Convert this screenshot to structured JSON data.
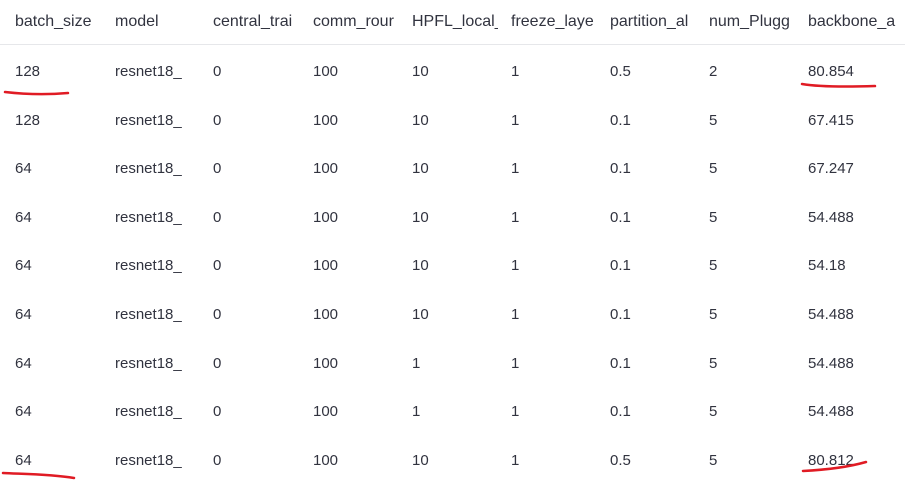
{
  "table": {
    "columns": [
      "batch_size",
      "model",
      "central_trai",
      "comm_rour",
      "HPFL_local_",
      "freeze_laye",
      "partition_al",
      "num_Plugg",
      "backbone_a"
    ],
    "rows": [
      [
        "128",
        "resnet18_",
        "0",
        "100",
        "10",
        "1",
        "0.5",
        "2",
        "80.854"
      ],
      [
        "128",
        "resnet18_",
        "0",
        "100",
        "10",
        "1",
        "0.1",
        "5",
        "67.415"
      ],
      [
        "64",
        "resnet18_",
        "0",
        "100",
        "10",
        "1",
        "0.1",
        "5",
        "67.247"
      ],
      [
        "64",
        "resnet18_",
        "0",
        "100",
        "10",
        "1",
        "0.1",
        "5",
        "54.488"
      ],
      [
        "64",
        "resnet18_",
        "0",
        "100",
        "10",
        "1",
        "0.1",
        "5",
        "54.18"
      ],
      [
        "64",
        "resnet18_",
        "0",
        "100",
        "10",
        "1",
        "0.1",
        "5",
        "54.488"
      ],
      [
        "64",
        "resnet18_",
        "0",
        "100",
        "1",
        "1",
        "0.1",
        "5",
        "54.488"
      ],
      [
        "64",
        "resnet18_",
        "0",
        "100",
        "1",
        "1",
        "0.1",
        "5",
        "54.488"
      ],
      [
        "64",
        "resnet18_",
        "0",
        "100",
        "10",
        "1",
        "0.5",
        "5",
        "80.812"
      ]
    ]
  },
  "colors": {
    "text": "#31333f",
    "grid": "#e6e7ea",
    "annotation": "#e01b24"
  }
}
